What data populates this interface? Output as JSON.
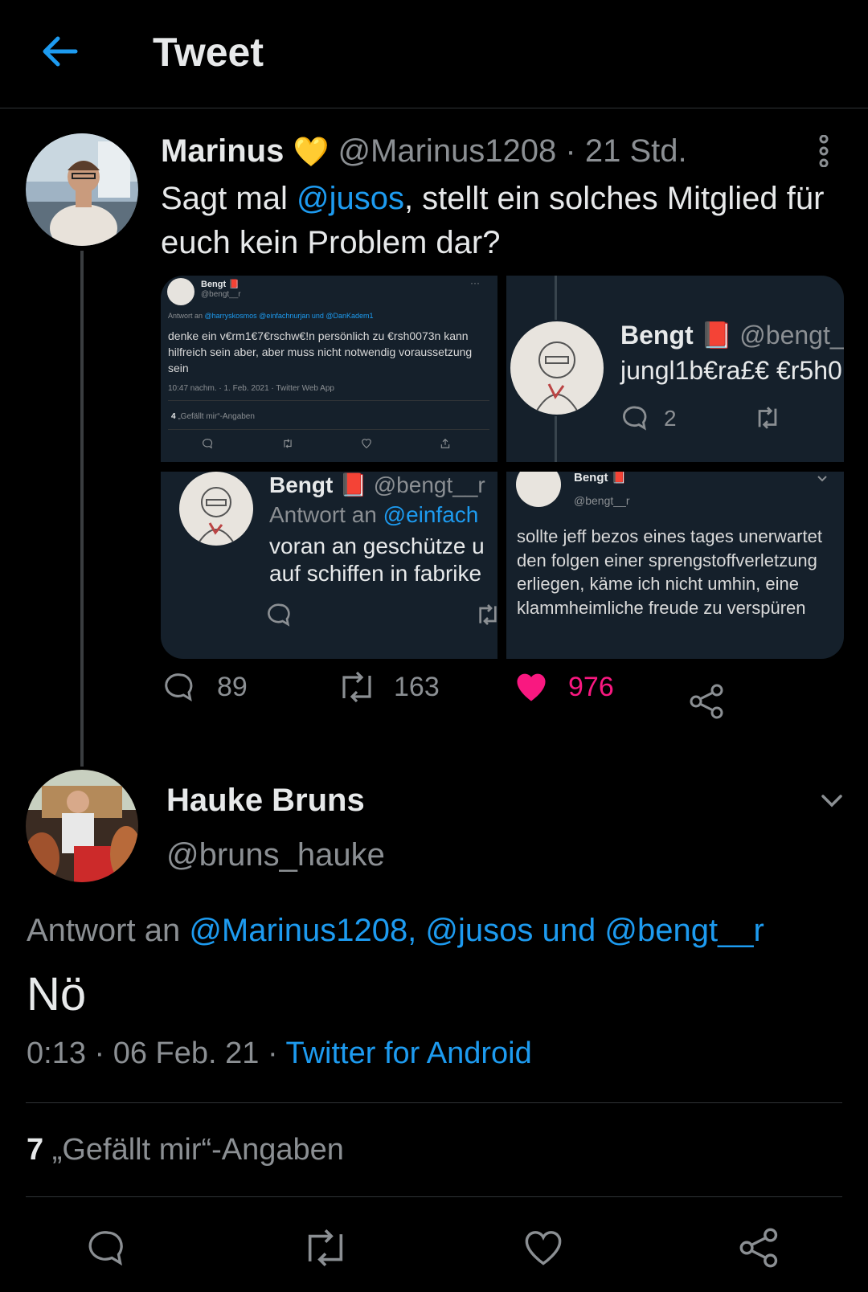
{
  "header": {
    "title": "Tweet"
  },
  "tweet": {
    "author_name": "Marinus",
    "author_badge": "💛",
    "author_handle": "@Marinus1208",
    "time": "· 21 Std.",
    "text_before": "Sagt mal ",
    "text_mention": "@jusos",
    "text_after": ", stellt ein solches Mitglied für euch kein Problem dar?",
    "media": {
      "m1": {
        "name": "Bengt 📕",
        "handle": "@bengt__r",
        "reply_prefix": "Antwort an ",
        "reply_targets": "@harryskosmos @einfachnurjan und @DanKadem1",
        "text": "denke ein v€rm1€7€rschw€!n persönlich zu €rsh0073n kann hilfreich sein aber, aber muss nicht notwendig voraussetzung sein",
        "meta": "10:47 nachm. · 1. Feb. 2021 · Twitter Web App",
        "likes_count": "4",
        "likes_label": "„Gefällt mir“-Angaben"
      },
      "m2": {
        "name": "Bengt 📕",
        "handle": "@bengt__",
        "text": "jungl1b€ra£€ €r5h0",
        "reply_count": "2"
      },
      "m3": {
        "name": "Bengt 📕",
        "handle": "@bengt__r",
        "reply_prefix": "Antwort an ",
        "reply_target": "@einfach",
        "line1": "voran an geschütze u",
        "line2": "auf schiffen in fabrike"
      },
      "m4": {
        "name": "Bengt 📕",
        "handle": "@bengt__r",
        "text": "sollte jeff bezos eines tages unerwartet den folgen einer sprengstoffverletzung erliegen, käme ich nicht umhin, eine klammheimliche freude zu verspüren"
      }
    },
    "replies": "89",
    "retweets": "163",
    "likes": "976"
  },
  "reply": {
    "author_name": "Hauke Bruns",
    "author_handle": "@bruns_hauke",
    "reply_prefix": "Antwort an ",
    "reply_targets": "@Marinus1208, @jusos und @bengt__r",
    "text": "Nö",
    "time": "0:13 · 06 Feb. 21 · ",
    "source": "Twitter for Android",
    "likes_count": "7",
    "likes_label": " „Gefällt mir“-Angaben"
  },
  "colors": {
    "accent": "#1d9bf0",
    "like": "#f91880",
    "background": "#000000",
    "media_bg": "#15202b"
  },
  "icons": [
    "back-arrow-icon",
    "more-vertical-icon",
    "reply-icon",
    "retweet-icon",
    "heart-filled-icon",
    "heart-icon",
    "share-icon",
    "chevron-down-icon"
  ]
}
